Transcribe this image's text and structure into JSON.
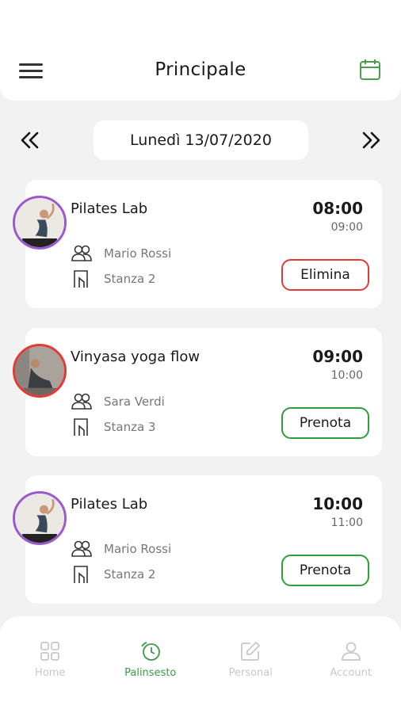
{
  "header": {
    "title": "Principale"
  },
  "date_nav": {
    "date_label": "Lunedì 13/07/2020"
  },
  "colors": {
    "accent_green": "#2e9e3a",
    "delete_red": "#e53935",
    "avatar_purple": "#9b59d0"
  },
  "classes": [
    {
      "name": "Pilates Lab",
      "start": "08:00",
      "end": "09:00",
      "instructor": "Mario Rossi",
      "room": "Stanza 2",
      "action": "Elimina"
    },
    {
      "name": "Vinyasa yoga flow",
      "start": "09:00",
      "end": "10:00",
      "instructor": "Sara Verdi",
      "room": "Stanza 3",
      "action": "Prenota"
    },
    {
      "name": "Pilates Lab",
      "start": "10:00",
      "end": "11:00",
      "instructor": "Mario Rossi",
      "room": "Stanza 2",
      "action": "Prenota"
    }
  ],
  "bottom_nav": {
    "items": [
      {
        "label": "Home",
        "icon": "grid-icon"
      },
      {
        "label": "Palinsesto",
        "icon": "schedule-icon"
      },
      {
        "label": "Personal",
        "icon": "edit-icon"
      },
      {
        "label": "Account",
        "icon": "user-icon"
      }
    ],
    "active": "Palinsesto"
  }
}
